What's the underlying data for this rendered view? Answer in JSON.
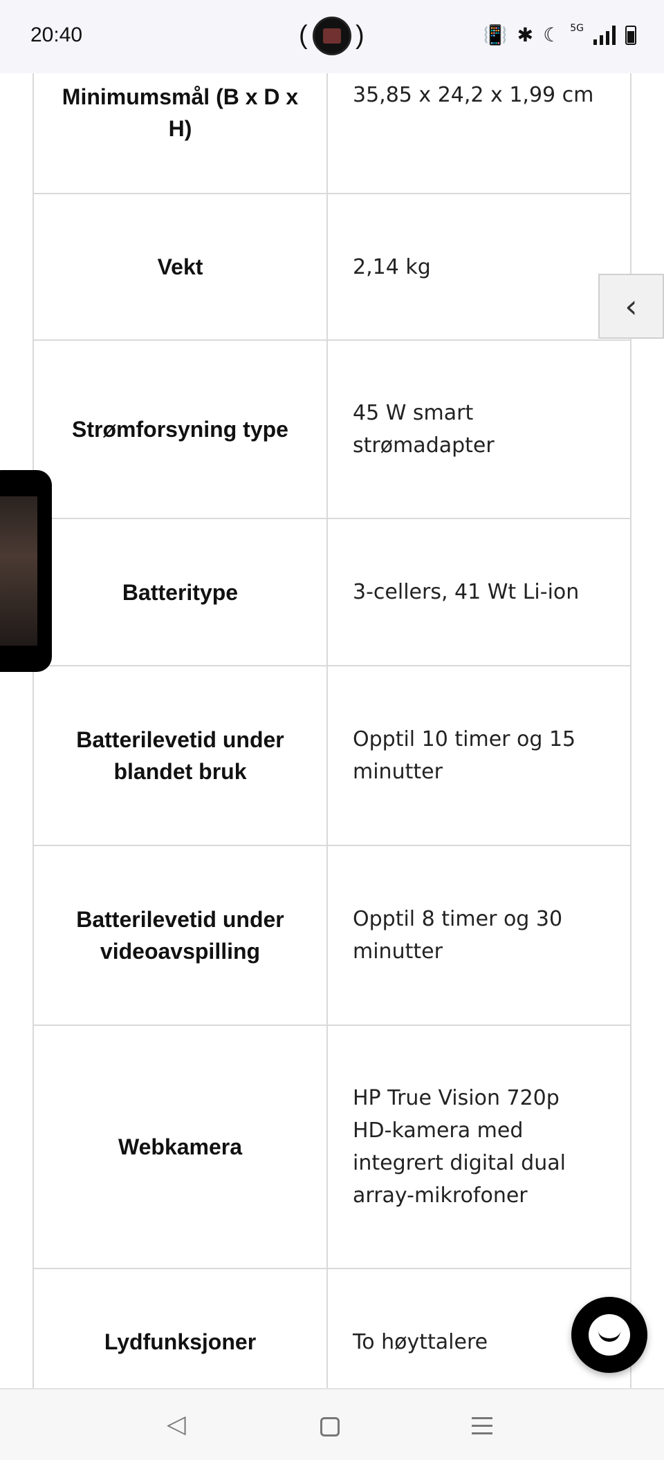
{
  "status_bar": {
    "time": "20:40",
    "network_label": "5G",
    "icons": [
      "vibrate-icon",
      "bluetooth-icon",
      "dnd-moon-icon",
      "signal-icon",
      "battery-icon"
    ]
  },
  "specs": [
    {
      "label": "Minimumsmål (B x D x H)",
      "value": "35,85 x 24,2 x 1,99 cm"
    },
    {
      "label": "Vekt",
      "value": "2,14 kg"
    },
    {
      "label": "Strømforsyning type",
      "value": "45 W smart strømadapter"
    },
    {
      "label": "Batteritype",
      "value": "3-cellers, 41 Wt Li-ion"
    },
    {
      "label": "Batterilevetid under blandet bruk",
      "value": "Opptil 10 timer og 15 minutter"
    },
    {
      "label": "Batterilevetid under videoavspilling",
      "value": "Opptil 8 timer og 30 minutter"
    },
    {
      "label": "Webkamera",
      "value": "HP True Vision 720p HD-kamera med integrert digital dual array-mikrofoner"
    },
    {
      "label": "Lydfunksjoner",
      "value": "To høyttalere"
    }
  ],
  "side_tab": {
    "icon": "chevron-left-icon",
    "glyph": "‹"
  },
  "nav": {
    "back_glyph": "◁"
  }
}
